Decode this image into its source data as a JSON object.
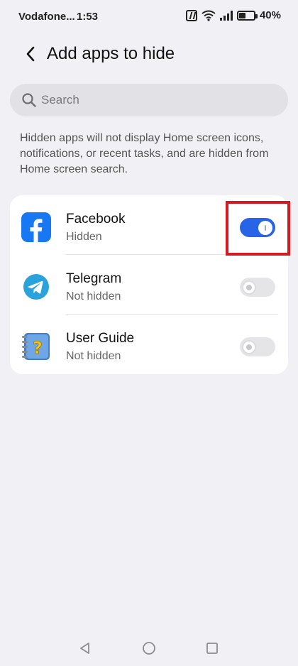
{
  "status_bar": {
    "carrier": "Vodafone...",
    "time": "1:53",
    "battery_percent": "40%",
    "icons": [
      "nfc-icon",
      "wifi-icon",
      "signal-icon",
      "battery-icon"
    ]
  },
  "header": {
    "title": "Add apps to hide",
    "back_icon": "back-arrow-icon"
  },
  "search": {
    "placeholder": "Search",
    "value": ""
  },
  "description": "Hidden apps will not display Home screen icons, notifications, or recent tasks, and are hidden from Home screen search.",
  "apps": [
    {
      "name": "Facebook",
      "status": "Hidden",
      "toggle_on": true,
      "icon": "facebook-icon"
    },
    {
      "name": "Telegram",
      "status": "Not hidden",
      "toggle_on": false,
      "icon": "telegram-icon"
    },
    {
      "name": "User Guide",
      "status": "Not hidden",
      "toggle_on": false,
      "icon": "user-guide-icon"
    }
  ],
  "colors": {
    "accent": "#2764e7",
    "highlight": "#d71921",
    "background": "#f1f1f5"
  },
  "nav_bar": {
    "icons": [
      "back-triangle-icon",
      "home-circle-icon",
      "recents-square-icon"
    ]
  }
}
